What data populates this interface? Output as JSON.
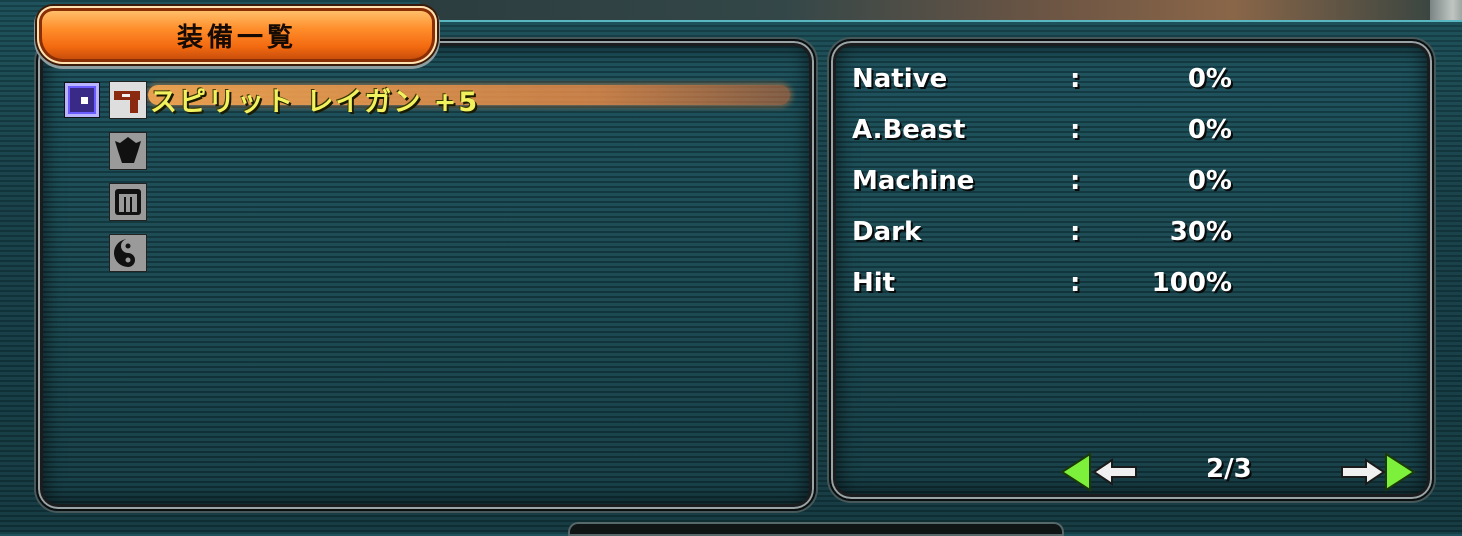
{
  "window": {
    "title": "装備一覧"
  },
  "equipment": {
    "selected_item": "スピリット レイガン +5",
    "slots": [
      {
        "icon": "weapon-gun-icon"
      },
      {
        "icon": "frame-armor-icon"
      },
      {
        "icon": "barrier-shield-icon"
      },
      {
        "icon": "unit-mag-icon"
      }
    ]
  },
  "stats": [
    {
      "label": "Native",
      "value": "0%"
    },
    {
      "label": "A.Beast",
      "value": "0%"
    },
    {
      "label": "Machine",
      "value": "0%"
    },
    {
      "label": "Dark",
      "value": "30%"
    },
    {
      "label": "Hit",
      "value": "100%"
    }
  ],
  "stat_separator": ":",
  "pager": {
    "page_text": "2/3"
  },
  "colors": {
    "accent_orange": "#f36a10",
    "item_name_yellow": "#f2f25e",
    "nav_green": "#7cf03a",
    "background_teal": "#18464f"
  }
}
